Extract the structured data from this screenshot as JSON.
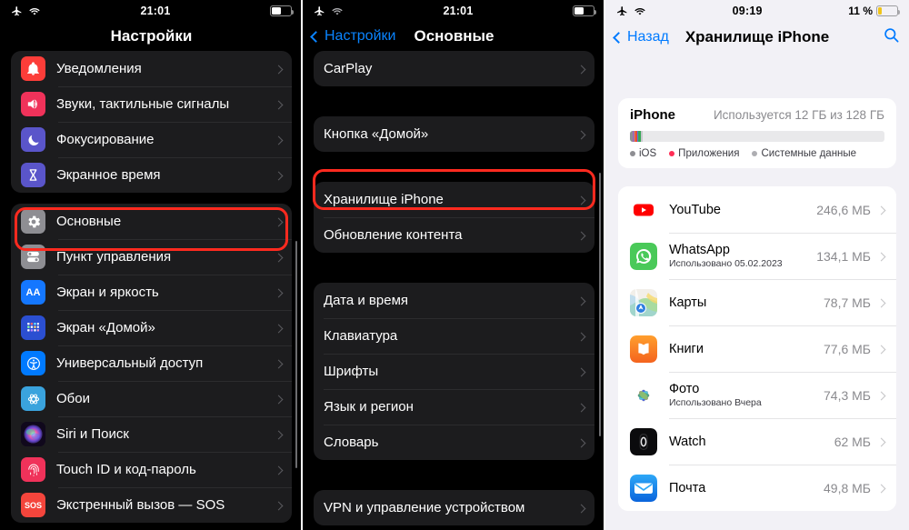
{
  "panels": {
    "settings": {
      "status": {
        "airplane": "airplane-icon",
        "wifi": "wifi-icon",
        "time": "21:01",
        "battery": "battery-icon"
      },
      "title": "Настройки",
      "rows": [
        {
          "label": "Уведомления",
          "icon": "bell-icon",
          "color": "#fc3d39"
        },
        {
          "label": "Звуки, тактильные сигналы",
          "icon": "speaker-icon",
          "color": "#f0325a"
        },
        {
          "label": "Фокусирование",
          "icon": "moon-icon",
          "color": "#5a55ca"
        },
        {
          "label": "Экранное время",
          "icon": "hourglass-icon",
          "color": "#5a55ca"
        }
      ],
      "rows2": [
        {
          "label": "Основные",
          "icon": "gear-icon",
          "color": "#8e8e93",
          "highlight": true
        },
        {
          "label": "Пункт управления",
          "icon": "toggles-icon",
          "color": "#8e8e93"
        },
        {
          "label": "Экран и яркость",
          "icon": "aa-icon",
          "color": "#1477ff"
        },
        {
          "label": "Экран «Домой»",
          "icon": "home-screen-icon",
          "color": "#2b4fd1"
        },
        {
          "label": "Универсальный доступ",
          "icon": "accessibility-icon",
          "color": "#007aff"
        },
        {
          "label": "Обои",
          "icon": "wallpaper-icon",
          "color": "#3aa3dd"
        },
        {
          "label": "Siri и Поиск",
          "icon": "siri-icon",
          "color": "#2b1a3f"
        },
        {
          "label": "Touch ID и код-пароль",
          "icon": "fingerprint-icon",
          "color": "#f0325a"
        },
        {
          "label": "Экстренный вызов — SOS",
          "icon": "sos-icon",
          "color": "#f4453c"
        }
      ]
    },
    "general": {
      "status": {
        "airplane": "airplane-icon",
        "wifi": "wifi-icon",
        "time": "21:01",
        "battery": "battery-icon"
      },
      "back_label": "Настройки",
      "title": "Основные",
      "group1": [
        {
          "label": "CarPlay"
        }
      ],
      "group2": [
        {
          "label": "Кнопка «Домой»"
        }
      ],
      "group3": [
        {
          "label": "Хранилище iPhone",
          "highlight": true
        },
        {
          "label": "Обновление контента"
        }
      ],
      "group4": [
        {
          "label": "Дата и время"
        },
        {
          "label": "Клавиатура"
        },
        {
          "label": "Шрифты"
        },
        {
          "label": "Язык и регион"
        },
        {
          "label": "Словарь"
        }
      ],
      "group5": [
        {
          "label": "VPN и управление устройством"
        }
      ]
    },
    "storage": {
      "status": {
        "airplane": "airplane-icon",
        "wifi": "wifi-icon",
        "time": "09:19",
        "battery_pct": "11 %",
        "battery": "battery-icon"
      },
      "back_label": "Назад",
      "title": "Хранилище iPhone",
      "search_icon": "search-icon",
      "device_name": "iPhone",
      "usage_text": "Используется 12 ГБ из 128 ГБ",
      "bar_segments": [
        {
          "name": "ios",
          "color": "#8e8e93",
          "width": 1.2
        },
        {
          "name": "photos",
          "color": "#a06ab4",
          "width": 0.5
        },
        {
          "name": "media",
          "color": "#e8803a",
          "width": 0.5
        },
        {
          "name": "apps",
          "color": "#e8453c",
          "width": 0.5
        },
        {
          "name": "mail",
          "color": "#4a7fd4",
          "width": 0.5
        },
        {
          "name": "messages",
          "color": "#3fa35c",
          "width": 0.5
        },
        {
          "name": "other",
          "color": "#34a853",
          "width": 0.5
        },
        {
          "name": "system",
          "color": "#c7c7cc",
          "width": 0.9
        }
      ],
      "legend": [
        {
          "label": "iOS",
          "color": "#8e8e93"
        },
        {
          "label": "Приложения",
          "color": "#ff2d55"
        },
        {
          "label": "Системные данные",
          "color": "#aeaeb2"
        }
      ],
      "apps": [
        {
          "name": "YouTube",
          "sub": "",
          "size": "246,6 МБ",
          "icon": "youtube-icon"
        },
        {
          "name": "WhatsApp",
          "sub": "Использовано 05.02.2023",
          "size": "134,1 МБ",
          "icon": "whatsapp-icon"
        },
        {
          "name": "Карты",
          "sub": "",
          "size": "78,7 МБ",
          "icon": "maps-icon"
        },
        {
          "name": "Книги",
          "sub": "",
          "size": "77,6 МБ",
          "icon": "books-icon"
        },
        {
          "name": "Фото",
          "sub": "Использовано Вчера",
          "size": "74,3 МБ",
          "icon": "photos-icon"
        },
        {
          "name": "Watch",
          "sub": "",
          "size": "62 МБ",
          "icon": "watch-icon"
        },
        {
          "name": "Почта",
          "sub": "",
          "size": "49,8 МБ",
          "icon": "mail-icon"
        }
      ]
    }
  }
}
